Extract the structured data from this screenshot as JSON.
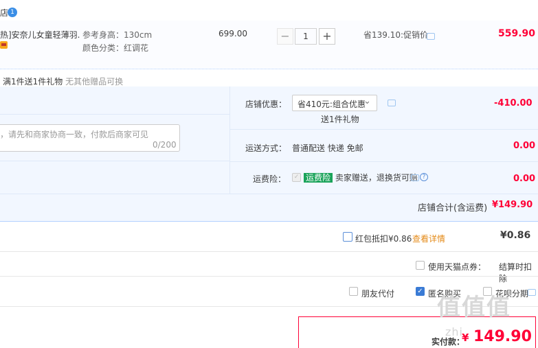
{
  "header": {
    "shop_tag": "店",
    "badge": "1"
  },
  "item": {
    "title": "热]安奈儿女童轻薄羽...",
    "height_label": "参考身高：130cm",
    "color_label": "颜色分类：红调花",
    "unit_price": "699.00",
    "quantity": "1",
    "minus": "−",
    "plus": "+",
    "promo": "省139.10:促销价",
    "subtotal": "559.90"
  },
  "gift": {
    "title": "满1件送1件礼物",
    "note": "无其他赠品可换"
  },
  "message": {
    "placeholder": "，请先和商家协商一致，付款后商家可见",
    "counter": "0/200"
  },
  "shop_discount": {
    "label": "店铺优惠：",
    "selected": "省410元:组合优惠",
    "gift_line": "送1件礼物",
    "amount": "-410.00"
  },
  "shipping": {
    "label": "运送方式：",
    "value": "普通配送 快递 免邮",
    "amount": "0.00"
  },
  "insurance": {
    "label": "运费险：",
    "tag": "运费险",
    "desc": "卖家赠送，退换货可赔",
    "amount": "0.00"
  },
  "shop_total": {
    "label": "店铺合计(含运费)",
    "amount": "¥149.90"
  },
  "redpacket": {
    "label": "红包抵扣¥0.86",
    "link": "查看详情",
    "amount": "¥0.86"
  },
  "points": {
    "label": "使用天猫点券：",
    "note": "结算时扣除"
  },
  "options": {
    "friend_pay": "朋友代付",
    "anonymous": "匿名购买",
    "huabei": "花呗分期"
  },
  "payment": {
    "label": "实付款：",
    "amount": "149.90",
    "currency": "¥"
  },
  "watermark": {
    "text": "值值值",
    "sub": "zhi"
  },
  "colors": {
    "accent_red": "#ff0036",
    "link_orange": "#e48a17",
    "panel_blue": "#f2f7ff",
    "tag_green": "#1aa35a"
  }
}
